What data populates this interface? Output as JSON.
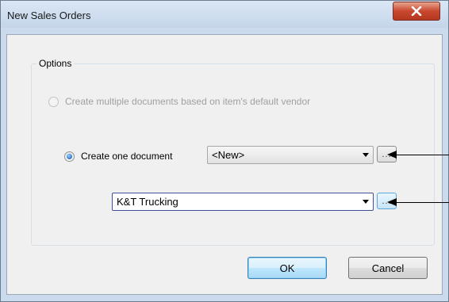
{
  "window": {
    "title": "New Sales Orders",
    "close_glyph": "X"
  },
  "options": {
    "group_label": "Options",
    "radio_multiple": {
      "label": "Create multiple documents based on item's default vendor",
      "checked": false,
      "enabled": false
    },
    "radio_one": {
      "label": "Create one document",
      "checked": true,
      "enabled": true
    },
    "document_combo": {
      "value": "<New>"
    },
    "document_lookup_label": "...",
    "customer_combo": {
      "value": "K&T Trucking"
    },
    "customer_lookup_label": "..."
  },
  "buttons": {
    "ok": "OK",
    "cancel": "Cancel"
  }
}
